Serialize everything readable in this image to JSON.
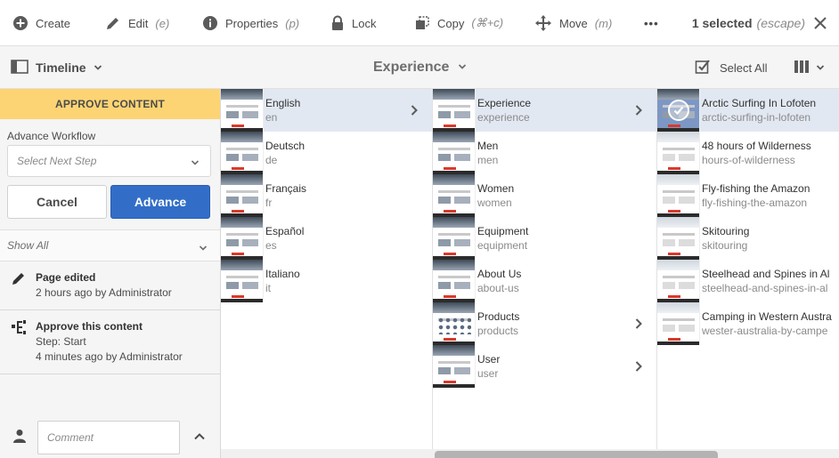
{
  "actionbar": {
    "create": {
      "label": "Create",
      "shortcut": ""
    },
    "edit": {
      "label": "Edit",
      "shortcut": "(e)"
    },
    "properties": {
      "label": "Properties",
      "shortcut": "(p)"
    },
    "lock": {
      "label": "Lock",
      "shortcut": ""
    },
    "copy": {
      "label": "Copy",
      "shortcut": "(⌘+c)"
    },
    "move": {
      "label": "Move",
      "shortcut": "(m)"
    },
    "more": "•••",
    "selected_count": "1 selected",
    "escape_hint": "(escape)"
  },
  "subbar": {
    "rail_label": "Timeline",
    "title": "Experience",
    "select_all": "Select All"
  },
  "rail": {
    "banner": "APPROVE CONTENT",
    "workflow_label": "Advance Workflow",
    "step_placeholder": "Select Next Step",
    "cancel": "Cancel",
    "advance": "Advance",
    "filter": "Show All",
    "events": [
      {
        "title": "Page edited",
        "lines": [
          "2 hours ago by Administrator"
        ],
        "icon": "pencil-icon"
      },
      {
        "title": "Approve this content",
        "lines": [
          "Step: Start",
          "4 minutes ago by Administrator"
        ],
        "icon": "workflow-icon"
      }
    ],
    "comment_placeholder": "Comment"
  },
  "columns": {
    "languages": [
      {
        "name": "English",
        "sub": "en",
        "active": true,
        "children": true
      },
      {
        "name": "Deutsch",
        "sub": "de"
      },
      {
        "name": "Français",
        "sub": "fr"
      },
      {
        "name": "Español",
        "sub": "es"
      },
      {
        "name": "Italiano",
        "sub": "it"
      }
    ],
    "sections": [
      {
        "name": "Experience",
        "sub": "experience",
        "active": true,
        "children": true
      },
      {
        "name": "Men",
        "sub": "men"
      },
      {
        "name": "Women",
        "sub": "women"
      },
      {
        "name": "Equipment",
        "sub": "equipment"
      },
      {
        "name": "About Us",
        "sub": "about-us"
      },
      {
        "name": "Products",
        "sub": "products",
        "children": true
      },
      {
        "name": "User",
        "sub": "user",
        "children": true
      }
    ],
    "pages": [
      {
        "name": "Arctic Surfing In Lofoten",
        "sub": "arctic-surfing-in-lofoten",
        "selected": true
      },
      {
        "name": "48 hours of Wilderness",
        "sub": "hours-of-wilderness"
      },
      {
        "name": "Fly-fishing the Amazon",
        "sub": "fly-fishing-the-amazon"
      },
      {
        "name": "Skitouring",
        "sub": "skitouring"
      },
      {
        "name": "Steelhead and Spines in Al",
        "sub": "steelhead-and-spines-in-al"
      },
      {
        "name": "Camping in Western Austra",
        "sub": "wester-australia-by-campe"
      }
    ]
  },
  "colors": {
    "banner": "#fdd474",
    "primary": "#326ec8",
    "active_row": "#e2e8f2"
  }
}
